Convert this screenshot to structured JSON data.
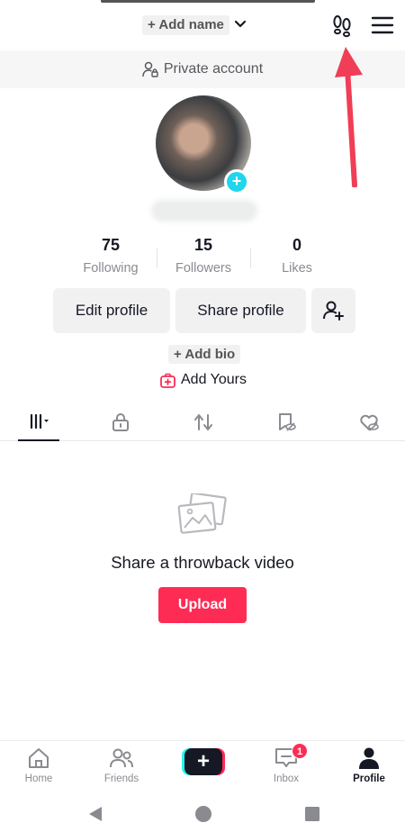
{
  "header": {
    "add_name_label": "+ Add name",
    "chevron_icon": "chevron-down-icon",
    "footprint_icon": "footprints-icon",
    "menu_icon": "hamburger-menu-icon"
  },
  "private_banner": {
    "label": "Private account",
    "icon": "lock-person-icon"
  },
  "profile": {
    "avatar_badge": "+"
  },
  "stats": [
    {
      "value": "75",
      "label": "Following"
    },
    {
      "value": "15",
      "label": "Followers"
    },
    {
      "value": "0",
      "label": "Likes"
    }
  ],
  "buttons": {
    "edit_profile": "Edit profile",
    "share_profile": "Share profile",
    "add_friend_icon": "add-friend-icon"
  },
  "bio": {
    "add_bio_label": "+ Add bio",
    "add_yours_label": "Add Yours"
  },
  "tabs": [
    "videos-grid-icon",
    "lock-icon",
    "repost-icon",
    "favorites-hidden-icon",
    "liked-hidden-icon"
  ],
  "empty_state": {
    "message": "Share a throwback video",
    "upload_label": "Upload",
    "icon": "photos-icon"
  },
  "bottom_nav": {
    "home": "Home",
    "friends": "Friends",
    "create": "+",
    "inbox": "Inbox",
    "inbox_badge": "1",
    "profile": "Profile"
  },
  "colors": {
    "accent": "#fe2c55",
    "cyan": "#25f4ee",
    "text": "#161823",
    "muted": "#8a8b91"
  }
}
